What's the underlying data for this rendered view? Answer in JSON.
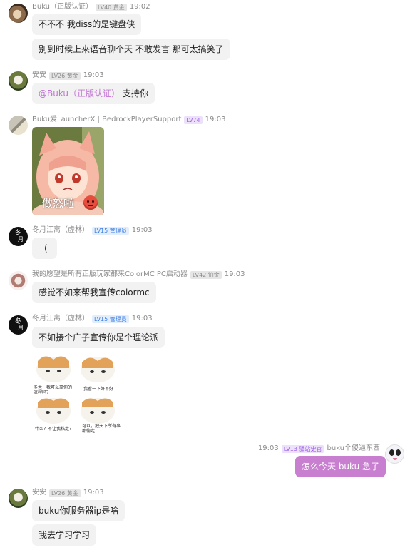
{
  "messages": [
    {
      "user": "Buku（正版认证）",
      "badge": "LV40 黄金",
      "time": "19:02",
      "bubbles": [
        "不不不 我diss的是键盘侠",
        "别到时候上来语音聊个天 不敢发言 那可太搞笑了"
      ]
    },
    {
      "user": "安安",
      "badge": "LV26 黄金",
      "time": "19:03",
      "mention": "@Buku（正版认证）",
      "text": "支持你"
    },
    {
      "user": "Buku爱LauncherX | BedrockPlayerSupport",
      "badge": "LV74",
      "time": "19:03",
      "sticker_caption": "做怒啦"
    },
    {
      "user": "冬月江离（虚林）",
      "badge": "LV15 管理员",
      "time": "19:03",
      "bubbles": [
        "("
      ]
    },
    {
      "user": "我的愿望是所有正版玩家都来ColorMC PC启动器",
      "badge": "LV42 铂金",
      "time": "19:03",
      "bubbles": [
        "感觉不如来帮我宣传colormc"
      ]
    },
    {
      "user": "冬月江离（虚林）",
      "badge": "LV15 管理员",
      "time": "19:03",
      "bubbles": [
        "不如接个广子宣传你是个理论派"
      ],
      "meme_texts": [
        "多大，我可以拿你的流程吗？",
        "我看一下好不好",
        "什么？不让我粘走？",
        "可以，把天下所有事都偷走"
      ]
    },
    {
      "user": "buku个傻逼东西",
      "badge": "LV13 驿站史官",
      "time": "19:03",
      "bubbles": [
        "怎么今天 buku 急了"
      ]
    },
    {
      "user": "安安",
      "badge": "LV26 黄金",
      "time": "19:03",
      "bubbles": [
        "buku你服务器ip是啥",
        "我去学习学习"
      ]
    }
  ]
}
